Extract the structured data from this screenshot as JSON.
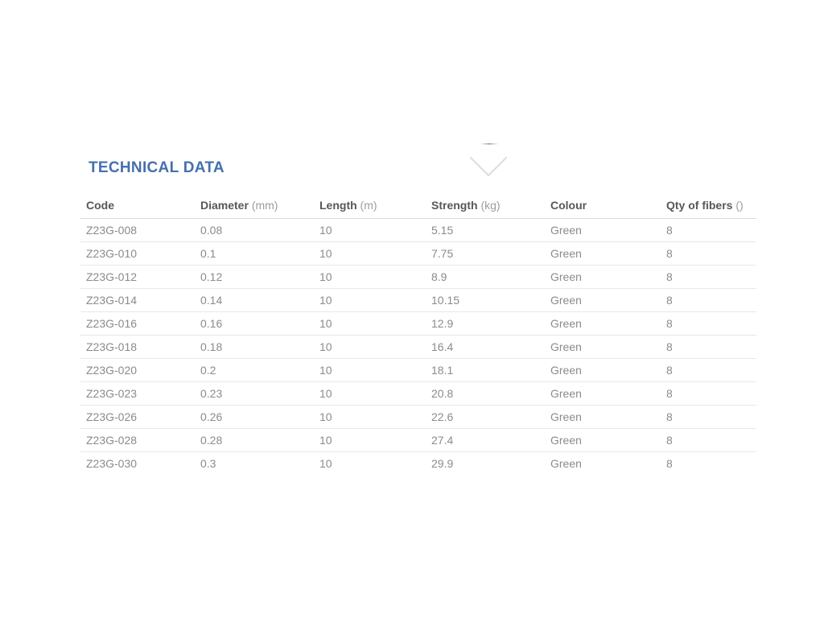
{
  "page": {
    "background": "#ffffff"
  },
  "section": {
    "title": "TECHNICAL DATA",
    "title_color": "#4470ad",
    "collapse_icon": "chevron-down-icon"
  },
  "table": {
    "columns": [
      {
        "label": "Code",
        "unit": ""
      },
      {
        "label": "Diameter",
        "unit": "(mm)"
      },
      {
        "label": "Length",
        "unit": "(m)"
      },
      {
        "label": "Strength",
        "unit": "(kg)"
      },
      {
        "label": "Colour",
        "unit": ""
      },
      {
        "label": "Qty of fibers",
        "unit": "()"
      }
    ],
    "rows": [
      [
        "Z23G-008",
        "0.08",
        "10",
        "5.15",
        "Green",
        "8"
      ],
      [
        "Z23G-010",
        "0.1",
        "10",
        "7.75",
        "Green",
        "8"
      ],
      [
        "Z23G-012",
        "0.12",
        "10",
        "8.9",
        "Green",
        "8"
      ],
      [
        "Z23G-014",
        "0.14",
        "10",
        "10.15",
        "Green",
        "8"
      ],
      [
        "Z23G-016",
        "0.16",
        "10",
        "12.9",
        "Green",
        "8"
      ],
      [
        "Z23G-018",
        "0.18",
        "10",
        "16.4",
        "Green",
        "8"
      ],
      [
        "Z23G-020",
        "0.2",
        "10",
        "18.1",
        "Green",
        "8"
      ],
      [
        "Z23G-023",
        "0.23",
        "10",
        "20.8",
        "Green",
        "8"
      ],
      [
        "Z23G-026",
        "0.26",
        "10",
        "22.6",
        "Green",
        "8"
      ],
      [
        "Z23G-028",
        "0.28",
        "10",
        "27.4",
        "Green",
        "8"
      ],
      [
        "Z23G-030",
        "0.3",
        "10",
        "29.9",
        "Green",
        "8"
      ]
    ]
  },
  "colors": {
    "title": "#4470ad",
    "header_text": "#55585a",
    "unit_text": "#9b9b9b",
    "cell_text": "#8b8b8b",
    "row_divider": "#e7e7e7",
    "header_divider": "#d9d9d9",
    "chevron": "#dedede"
  }
}
